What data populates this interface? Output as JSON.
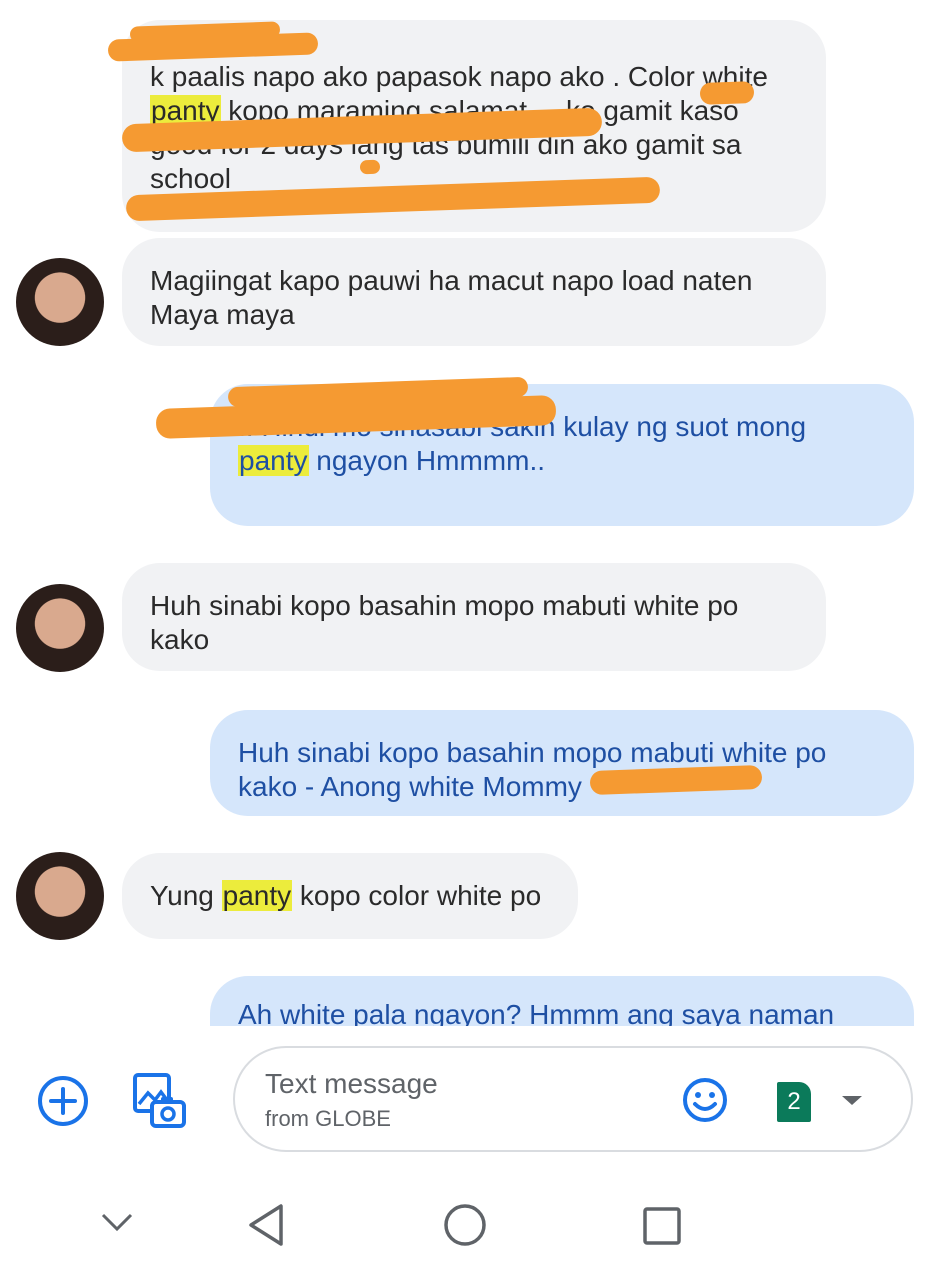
{
  "messages": [
    {
      "dir": "in",
      "before": "k paalis napo ako papasok napo ako . Color white ",
      "mark": "panty",
      "after": " kopo maraming salamat ... ko gamit kaso good for 2 days lang tas bumili din ako gamit sa school"
    },
    {
      "dir": "in",
      "before": "Magiingat kapo pauwi ha macut napo load naten Maya maya",
      "mark": "",
      "after": ""
    },
    {
      "dir": "out",
      "before": ".. Hindi mo sinasabi sakin kulay ng suot mong ",
      "mark": "panty",
      "after": " ngayon Hmmmm.."
    },
    {
      "dir": "in",
      "before": "Huh sinabi kopo basahin mopo mabuti white po kako",
      "mark": "",
      "after": ""
    },
    {
      "dir": "out",
      "before": "Huh sinabi kopo basahin mopo mabuti white po kako - Anong white Mommy",
      "mark": "",
      "after": ""
    },
    {
      "dir": "in",
      "before": "Yung ",
      "mark": "panty",
      "after": " kopo color white po"
    },
    {
      "dir": "out",
      "before": "Ah white pala ngayon? Hmmm ang saya naman",
      "mark": "",
      "after": ""
    }
  ],
  "composer": {
    "placeholder": "Text message",
    "carrier": "from GLOBE",
    "sim_number": "2"
  },
  "icons": {
    "add": "plus-circle-icon",
    "gallery": "image-gallery-icon",
    "emoji": "emoji-icon",
    "sim": "sim-card-icon",
    "dropdown": "chevron-down-icon"
  },
  "colors": {
    "incoming_bubble": "#f1f2f4",
    "outgoing_bubble": "#d5e6fb",
    "outgoing_text": "#1e4fa3",
    "highlight": "#ecec3c",
    "accent": "#1a73e8",
    "sim_badge": "#0b7a5a",
    "redaction": "#f59a32"
  }
}
